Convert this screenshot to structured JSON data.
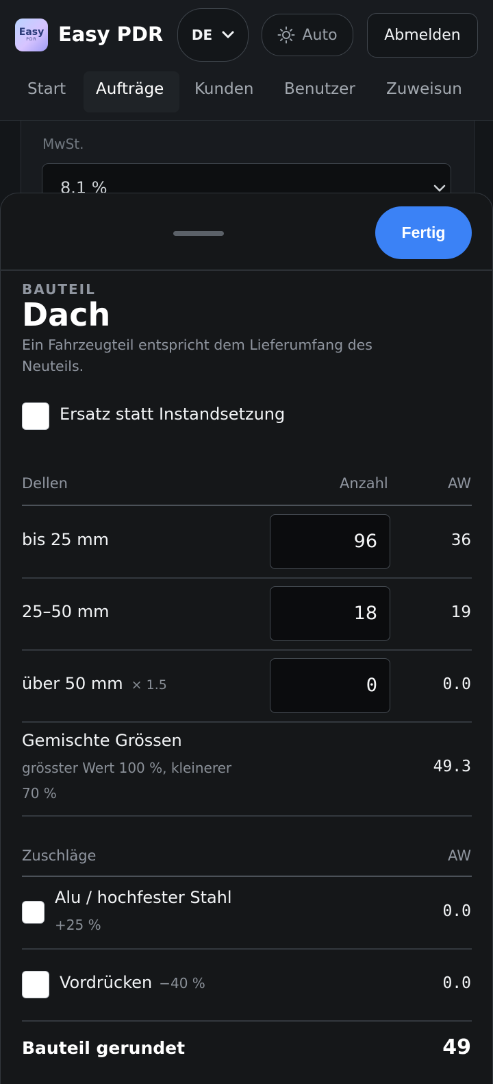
{
  "app": {
    "logo_line1": "Easy",
    "logo_line2": "PDR",
    "title": "Easy PDR",
    "language": "DE",
    "theme_label": "Auto",
    "logout_label": "Abmelden"
  },
  "nav": {
    "items": [
      "Start",
      "Aufträge",
      "Kunden",
      "Benutzer",
      "Zuweisun"
    ],
    "active": "Aufträge"
  },
  "background_form": {
    "vat_label": "MwSt.",
    "vat_value": "8.1 %"
  },
  "sheet": {
    "done_label": "Fertig",
    "eyebrow": "BAUTEIL",
    "title": "Dach",
    "description": "Ein Fahrzeugteil entspricht dem Lieferumfang des Neuteils.",
    "replace_label": "Ersatz statt Instandsetzung",
    "replace_checked": false
  },
  "dents": {
    "header": "Dellen",
    "count_header": "Anzahl",
    "aw_header": "AW",
    "rows": [
      {
        "label": "bis 25 mm",
        "multiplier": "",
        "count": "96",
        "aw": "36"
      },
      {
        "label": "25–50 mm",
        "multiplier": "",
        "count": "18",
        "aw": "19"
      },
      {
        "label": "über 50 mm",
        "multiplier": "× 1.5",
        "count": "0",
        "aw": "0.0"
      }
    ],
    "mixed": {
      "label": "Gemischte Grössen",
      "note_line1": "grösster Wert 100 %, kleinerer",
      "note_line2": "70 %",
      "aw": "49.3"
    }
  },
  "surcharges": {
    "header": "Zuschläge",
    "aw_header": "AW",
    "items": [
      {
        "label": "Alu / hochfester Stahl",
        "note": "+25 %",
        "aw": "0.0",
        "checked": false
      },
      {
        "label": "Vordrücken",
        "note": "−40 %",
        "aw": "0.0",
        "checked": false
      }
    ]
  },
  "total": {
    "label": "Bauteil gerundet",
    "value": "49"
  },
  "colors": {
    "accent": "#3b82f6",
    "background": "#131619",
    "sheet": "#151719"
  }
}
